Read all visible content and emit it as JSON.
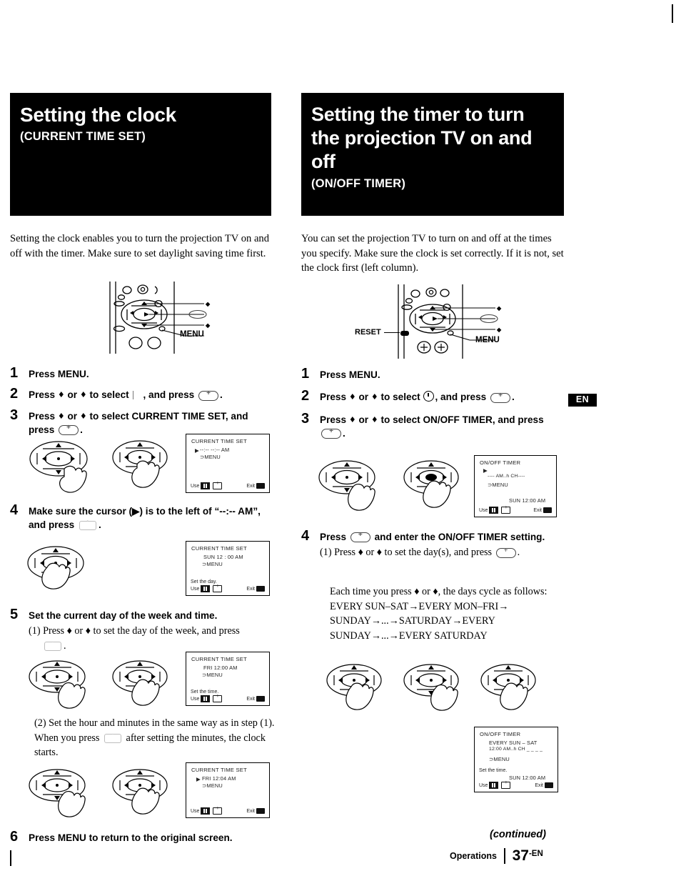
{
  "left": {
    "banner": {
      "title": "Setting the clock",
      "subtitle": "(CURRENT TIME SET)"
    },
    "intro": "Setting the clock enables you to turn the projection TV on and off with the timer. Make sure to set daylight saving time first.",
    "remote_labels": {
      "menu": "MENU"
    },
    "steps": [
      {
        "num": "1",
        "head_a": "Press MENU."
      },
      {
        "num": "2",
        "head_a": "Press ",
        "head_b": " or ",
        "head_c": " to select ",
        "head_d": ", and press ",
        "head_e": "."
      },
      {
        "num": "3",
        "head_a": "Press ",
        "head_b": " or ",
        "head_c": " to select CURRENT TIME SET, and press ",
        "head_d": "."
      },
      {
        "num": "4",
        "head_a": "Make sure the cursor (▶) is to the left of “--:-- AM”, and press ",
        "head_b": "."
      },
      {
        "num": "5",
        "head_a": "Set the current day of the week and time.",
        "sub1": "(1) Press ♦ or ♦ to set the day of the week, and press ",
        "sub2": "(2) Set the hour and minutes in the same way as in step (1). When you press ",
        "sub2b": " after setting the minutes, the clock starts."
      },
      {
        "num": "6",
        "head_a": "Press MENU to return to the original screen."
      }
    ],
    "osd": [
      {
        "title": "CURRENT TIME SET",
        "line1": "--:-- --:-- AM",
        "line2": "⊃MENU",
        "cursor": "▶",
        "hint": "",
        "use": "Use",
        "exit": "Exit"
      },
      {
        "title": "CURRENT TIME SET",
        "line1": "SUN  12 : 00 AM",
        "line2": "⊃MENU",
        "cursor": "",
        "hint": "Set the day.",
        "use": "Use",
        "exit": "Exit"
      },
      {
        "title": "CURRENT TIME SET",
        "line1": "FRI   12:00 AM",
        "line2": "⊃MENU",
        "cursor": "",
        "hint": "Set the time.",
        "use": "Use",
        "exit": "Exit"
      },
      {
        "title": "CURRENT TIME SET",
        "line1": "FRI  12:04 AM",
        "line2": "⊃MENU",
        "cursor": "▶",
        "hint": "",
        "use": "Use",
        "exit": "Exit"
      }
    ]
  },
  "right": {
    "banner": {
      "title": "Setting the timer to turn the projection TV on and off",
      "subtitle": "(ON/OFF TIMER)"
    },
    "intro": "You can set the projection TV to turn on and off at the times you specify. Make sure the clock is set correctly. If it is not, set the clock first (left column).",
    "remote_labels": {
      "reset": "RESET",
      "menu": "MENU"
    },
    "steps": [
      {
        "num": "1",
        "head_a": "Press MENU."
      },
      {
        "num": "2",
        "head_a": "Press ",
        "head_b": " or ",
        "head_c": " to select ",
        "head_d": ", and press ",
        "head_e": "."
      },
      {
        "num": "3",
        "head_a": "Press ",
        "head_b": " or ",
        "head_c": " to select ON/OFF TIMER, and press ",
        "head_d": "."
      },
      {
        "num": "4",
        "head_a": "Press ",
        "head_b": " and enter the ON/OFF TIMER setting.",
        "sub1": "(1) Press ♦ or ♦ to set the day(s), and press ",
        "cycle_intro": "Each time you press ♦ or ♦, the days cycle as follows:",
        "cycle_lines": [
          "EVERY SUN–SAT→EVERY MON–FRI→",
          "SUNDAY→...→SATURDAY→EVERY",
          "SUNDAY→...→EVERY SATURDAY"
        ]
      }
    ],
    "osd": [
      {
        "title": "ON/OFF TIMER",
        "line1": "---- AM..h CH----",
        "line2": "⊃MENU",
        "cursor": "▶",
        "time": "SUN  12:00 AM",
        "hint": "",
        "use": "Use",
        "exit": "Exit"
      },
      {
        "title": "ON/OFF TIMER",
        "line1": "EVERY  SUN – SAT",
        "line1b": "12:00 AM..h  CH _ _ _ _",
        "line2": "⊃MENU",
        "cursor": "",
        "time": "SUN 12:00 AM",
        "hint": "Set the time.",
        "use": "Use",
        "exit": "Exit"
      }
    ]
  },
  "badge": {
    "en": "EN"
  },
  "footer": {
    "continued": "(continued)",
    "section": "Operations",
    "page": "37",
    "page_suffix": "-EN"
  },
  "glyphs": {
    "up_arrow": "♦",
    "down_arrow": "♦",
    "right_cursor": "▶"
  }
}
